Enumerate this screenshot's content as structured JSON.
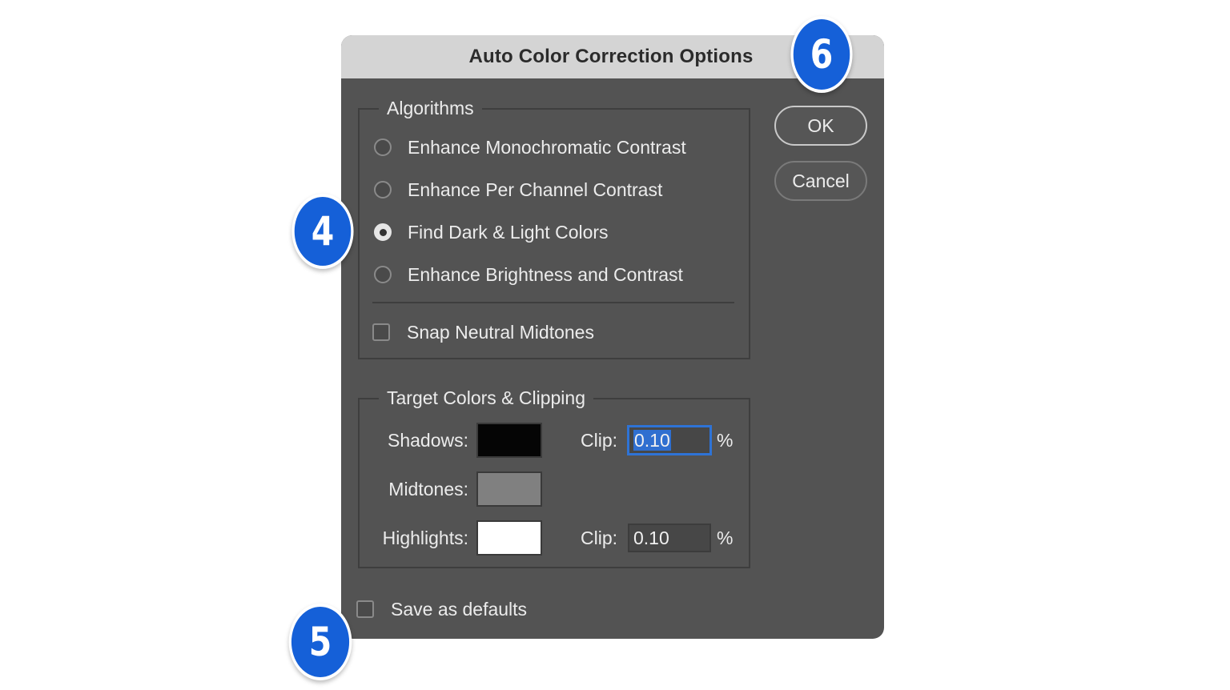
{
  "dialog": {
    "title": "Auto Color Correction Options"
  },
  "algorithms": {
    "legend": "Algorithms",
    "options": [
      {
        "label": "Enhance Monochromatic Contrast",
        "selected": false
      },
      {
        "label": "Enhance Per Channel Contrast",
        "selected": false
      },
      {
        "label": "Find Dark & Light Colors",
        "selected": true
      },
      {
        "label": "Enhance Brightness and Contrast",
        "selected": false
      }
    ],
    "snap_label": "Snap Neutral Midtones",
    "snap_checked": false
  },
  "target": {
    "legend": "Target Colors & Clipping",
    "shadows_label": "Shadows:",
    "midtones_label": "Midtones:",
    "highlights_label": "Highlights:",
    "shadows_color": "#050505",
    "midtones_color": "#808080",
    "highlights_color": "#ffffff",
    "clip_label": "Clip:",
    "shadows_clip": "0.10",
    "highlights_clip": "0.10",
    "percent": "%"
  },
  "buttons": {
    "ok": "OK",
    "cancel": "Cancel"
  },
  "save_defaults": {
    "label": "Save as defaults",
    "checked": false
  },
  "badges": {
    "four": "4",
    "five": "5",
    "six": "6"
  },
  "colors": {
    "dialog_bg": "#535353",
    "titlebar_bg": "#d4d4d4",
    "badge_blue": "#1560d8",
    "focus_blue": "#2e73d6"
  }
}
